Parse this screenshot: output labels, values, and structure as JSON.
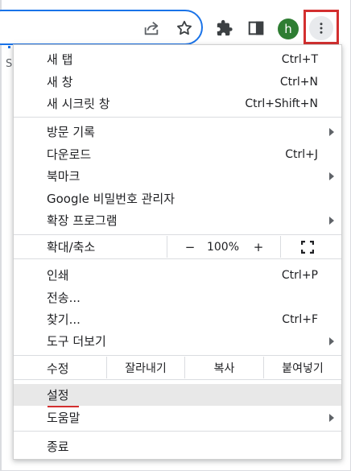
{
  "toolbar": {
    "share_icon": "share-icon",
    "bookmark_icon": "star-icon",
    "extensions_icon": "puzzle-icon",
    "side_panel_icon": "side-panel-icon",
    "avatar_initial": "h",
    "menu_icon": "more-vert-icon"
  },
  "page_fragment": "S",
  "menu": {
    "group1": [
      {
        "label": "새 탭",
        "shortcut": "Ctrl+T"
      },
      {
        "label": "새 창",
        "shortcut": "Ctrl+N"
      },
      {
        "label": "새 시크릿 창",
        "shortcut": "Ctrl+Shift+N"
      }
    ],
    "group2": [
      {
        "label": "방문 기록",
        "shortcut": "",
        "submenu": true
      },
      {
        "label": "다운로드",
        "shortcut": "Ctrl+J"
      },
      {
        "label": "북마크",
        "shortcut": "",
        "submenu": true
      },
      {
        "label": "Google 비밀번호 관리자",
        "shortcut": ""
      },
      {
        "label": "확장 프로그램",
        "shortcut": "",
        "submenu": true
      }
    ],
    "zoom": {
      "label": "확대/축소",
      "minus": "−",
      "value": "100%",
      "plus": "+",
      "fullscreen_icon": "fullscreen-icon"
    },
    "group3": [
      {
        "label": "인쇄",
        "shortcut": "Ctrl+P"
      },
      {
        "label": "전송...",
        "shortcut": ""
      },
      {
        "label": "찾기...",
        "shortcut": "Ctrl+F"
      },
      {
        "label": "도구 더보기",
        "shortcut": "",
        "submenu": true
      }
    ],
    "edit": {
      "label": "수정",
      "cut": "잘라내기",
      "copy": "복사",
      "paste": "붙여넣기"
    },
    "group4": [
      {
        "label": "설정",
        "shortcut": "",
        "selected": true
      },
      {
        "label": "도움말",
        "shortcut": "",
        "submenu": true
      }
    ],
    "exit": {
      "label": "종료"
    }
  },
  "colors": {
    "accent": "#1a73e8",
    "highlight": "#d32f2f",
    "avatar": "#2e7d32"
  }
}
